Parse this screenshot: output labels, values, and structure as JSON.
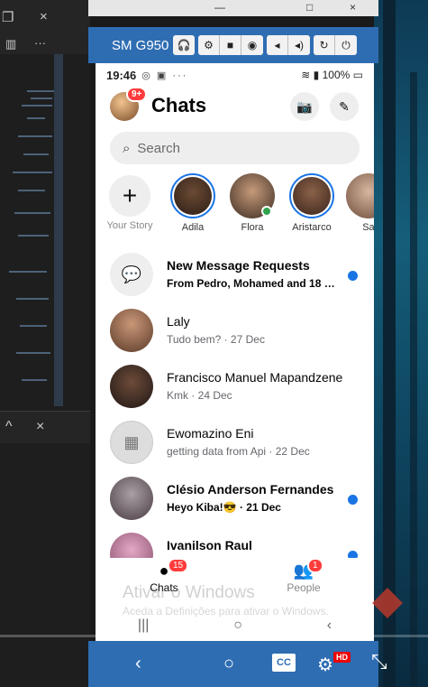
{
  "editor": {
    "panel_chevron": "^",
    "panel_close": "×",
    "more": "···",
    "close": "×"
  },
  "window": {
    "minimize": "—",
    "maximize": "□",
    "close": "×"
  },
  "toolbar": {
    "title": "SM G950",
    "buttons": [
      "headphones-icon",
      "gear-icon",
      "camera-video-icon",
      "camera-icon",
      "volume-down-icon",
      "volume-up-icon",
      "rotate-icon",
      "power-icon"
    ]
  },
  "status": {
    "time": "19:46",
    "battery": "100%",
    "notif_icons": "◎ ▣ ···"
  },
  "header": {
    "title": "Chats",
    "avatar_badge": "9+"
  },
  "search": {
    "placeholder": "Search"
  },
  "stories": [
    {
      "label": "Your Story"
    },
    {
      "label": "Adila"
    },
    {
      "label": "Flora"
    },
    {
      "label": "Aristarco"
    },
    {
      "label": "San"
    }
  ],
  "chats": [
    {
      "name": "New Message Requests",
      "preview": "From Pedro, Mohamed and 18 ot...",
      "unread": true
    },
    {
      "name": "Laly",
      "preview": "Tudo bem? · 27 Dec",
      "unread": false
    },
    {
      "name": "Francisco Manuel Mapandzene",
      "preview": "Kmk · 24 Dec",
      "unread": false
    },
    {
      "name": "Ewomazino Eni",
      "preview": "getting data from Api · 22 Dec",
      "unread": false
    },
    {
      "name": "Clésio Anderson Fernandes",
      "preview": "Heyo Kiba!😎 · 21 Dec",
      "unread": true
    },
    {
      "name": "Ivanilson Raul",
      "preview": "",
      "unread": true
    }
  ],
  "tabs": [
    {
      "label": "Chats",
      "badge": "15"
    },
    {
      "label": "People",
      "badge": "1"
    }
  ],
  "watermark": {
    "line1": "Ativar o Windows",
    "line2": "Aceda a Definições para ativar o Windows."
  },
  "player": {
    "cc": "CC",
    "hd": "HD",
    "progress": 0.0
  },
  "colors": {
    "accent": "#1a74e4",
    "toolbar": "#2f6db3",
    "badge": "#ff3b3b"
  }
}
